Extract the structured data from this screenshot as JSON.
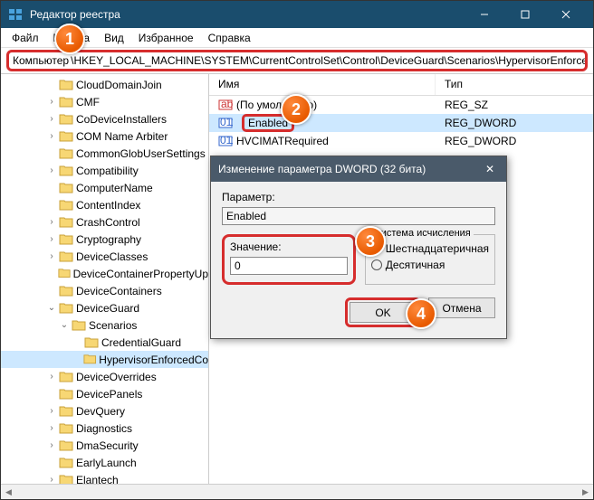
{
  "window": {
    "title": "Редактор реестра"
  },
  "menus": {
    "file": "Файл",
    "edit": "Правка",
    "view": "Вид",
    "favorites": "Избранное",
    "help": "Справка"
  },
  "addressbar": {
    "label": "Компьютер",
    "path": "\\HKEY_LOCAL_MACHINE\\SYSTEM\\CurrentControlSet\\Control\\DeviceGuard\\Scenarios\\HypervisorEnforce"
  },
  "tree": [
    {
      "exp": "",
      "d": 3,
      "name": "CloudDomainJoin"
    },
    {
      "exp": ">",
      "d": 3,
      "name": "CMF"
    },
    {
      "exp": ">",
      "d": 3,
      "name": "CoDeviceInstallers"
    },
    {
      "exp": ">",
      "d": 3,
      "name": "COM Name Arbiter"
    },
    {
      "exp": "",
      "d": 3,
      "name": "CommonGlobUserSettings"
    },
    {
      "exp": ">",
      "d": 3,
      "name": "Compatibility"
    },
    {
      "exp": "",
      "d": 3,
      "name": "ComputerName"
    },
    {
      "exp": "",
      "d": 3,
      "name": "ContentIndex"
    },
    {
      "exp": ">",
      "d": 3,
      "name": "CrashControl"
    },
    {
      "exp": ">",
      "d": 3,
      "name": "Cryptography"
    },
    {
      "exp": ">",
      "d": 3,
      "name": "DeviceClasses"
    },
    {
      "exp": "",
      "d": 3,
      "name": "DeviceContainerPropertyUp"
    },
    {
      "exp": "",
      "d": 3,
      "name": "DeviceContainers"
    },
    {
      "exp": "v",
      "d": 3,
      "name": "DeviceGuard"
    },
    {
      "exp": "v",
      "d": 4,
      "name": "Scenarios"
    },
    {
      "exp": "",
      "d": 5,
      "name": "CredentialGuard"
    },
    {
      "exp": "",
      "d": 5,
      "name": "HypervisorEnforcedCo",
      "sel": true
    },
    {
      "exp": ">",
      "d": 3,
      "name": "DeviceOverrides"
    },
    {
      "exp": "",
      "d": 3,
      "name": "DevicePanels"
    },
    {
      "exp": ">",
      "d": 3,
      "name": "DevQuery"
    },
    {
      "exp": ">",
      "d": 3,
      "name": "Diagnostics"
    },
    {
      "exp": ">",
      "d": 3,
      "name": "DmaSecurity"
    },
    {
      "exp": "",
      "d": 3,
      "name": "EarlyLaunch"
    },
    {
      "exp": ">",
      "d": 3,
      "name": "Elantech"
    }
  ],
  "cols": {
    "name": "Имя",
    "type": "Тип"
  },
  "values": [
    {
      "name": "(По умолчанию)",
      "type": "REG_SZ",
      "k": "str"
    },
    {
      "name": "Enabled",
      "type": "REG_DWORD",
      "k": "dw",
      "sel": true
    },
    {
      "name": "HVCIMATRequired",
      "type": "REG_DWORD",
      "k": "dw"
    }
  ],
  "dialog": {
    "title": "Изменение параметра DWORD (32 бита)",
    "param_label": "Параметр:",
    "param_value": "Enabled",
    "value_label": "Значение:",
    "value_value": "0",
    "radix_label": "Система исчисления",
    "radix_hex": "Шестнадцатеричная",
    "radix_dec": "Десятичная",
    "ok": "OK",
    "cancel": "Отмена"
  },
  "callouts": {
    "c1": "1",
    "c2": "2",
    "c3": "3",
    "c4": "4"
  }
}
